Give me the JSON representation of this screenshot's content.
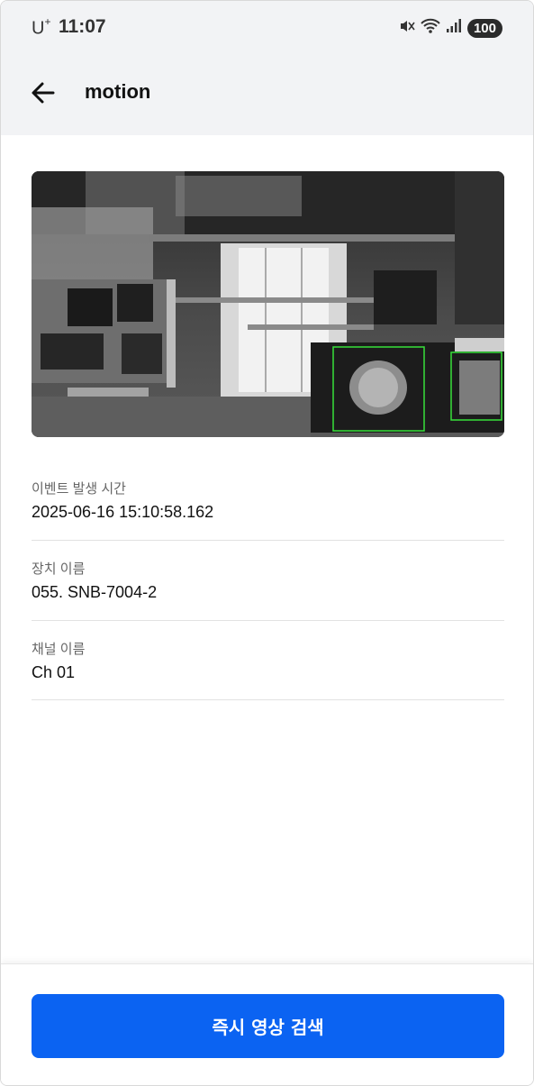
{
  "status_bar": {
    "carrier": "U",
    "carrier_sup": "+",
    "time": "11:07",
    "battery": "100",
    "icons": [
      "mute-icon",
      "wifi-icon",
      "signal-icon"
    ]
  },
  "header": {
    "back_icon": "arrow-left-icon",
    "title": "motion"
  },
  "snapshot": {
    "description_icon": "camera-snapshot",
    "detection_box_color": "#36e03a"
  },
  "details": [
    {
      "label": "이벤트 발생 시간",
      "value": "2025-06-16 15:10:58.162"
    },
    {
      "label": "장치 이름",
      "value": "055. SNB-7004-2"
    },
    {
      "label": "채널 이름",
      "value": "Ch 01"
    }
  ],
  "actions": {
    "instant_search_label": "즉시 영상 검색",
    "primary_color": "#0b63f2"
  }
}
